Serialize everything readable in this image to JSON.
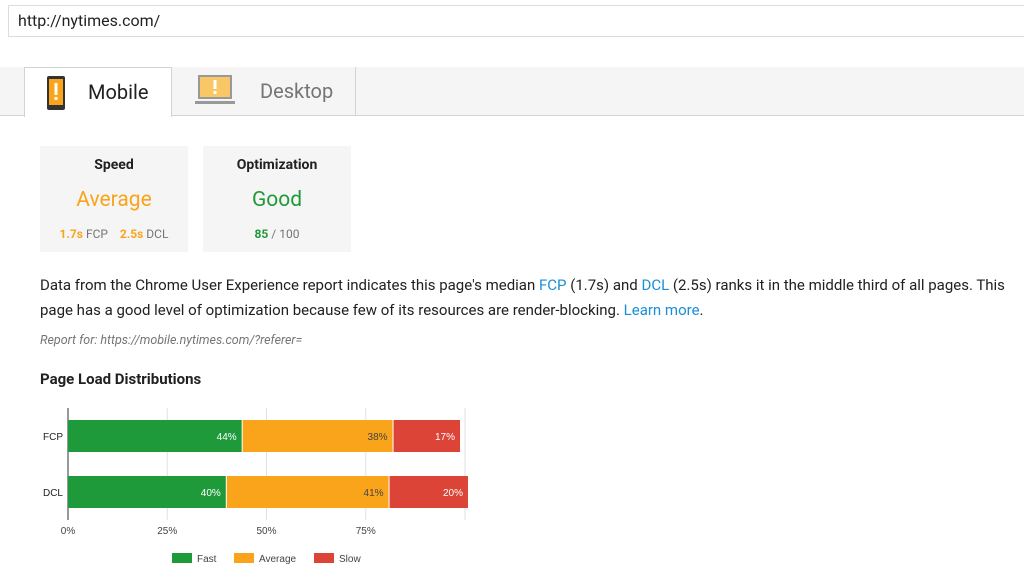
{
  "url": "http://nytimes.com/",
  "tabs": {
    "mobile_label": "Mobile",
    "desktop_label": "Desktop"
  },
  "cards": {
    "speed": {
      "title": "Speed",
      "value": "Average",
      "fcp_value": "1.7s",
      "fcp_label": "FCP",
      "dcl_value": "2.5s",
      "dcl_label": "DCL"
    },
    "optimization": {
      "title": "Optimization",
      "value": "Good",
      "score": "85",
      "score_max": "/ 100"
    }
  },
  "summary": {
    "part1": "Data from the Chrome User Experience report indicates this page's median ",
    "fcp_link": "FCP",
    "part2": " (1.7s) and ",
    "dcl_link": "DCL",
    "part3": " (2.5s) ranks it in the middle third of all pages. This page has a good level of optimization because few of its resources are render-blocking. ",
    "learn_more": "Learn more",
    "end": "."
  },
  "report_for": "Report for: https://mobile.nytimes.com/?referer=",
  "section_title": "Page Load Distributions",
  "colors": {
    "fast": "#1f9a3a",
    "average": "#f9a41a",
    "slow": "#db4437"
  },
  "chart_data": {
    "type": "bar",
    "orientation": "horizontal",
    "stacked": true,
    "categories": [
      "FCP",
      "DCL"
    ],
    "series": [
      {
        "name": "Fast",
        "values": [
          44,
          40
        ]
      },
      {
        "name": "Average",
        "values": [
          38,
          41
        ]
      },
      {
        "name": "Slow",
        "values": [
          17,
          20
        ]
      }
    ],
    "data_labels": [
      [
        "44%",
        "38%",
        "17%"
      ],
      [
        "40%",
        "41%",
        "20%"
      ]
    ],
    "xticks": [
      "0%",
      "25%",
      "50%",
      "75%"
    ],
    "xlim": [
      0,
      100
    ],
    "grid": true,
    "legend_position": "bottom"
  }
}
